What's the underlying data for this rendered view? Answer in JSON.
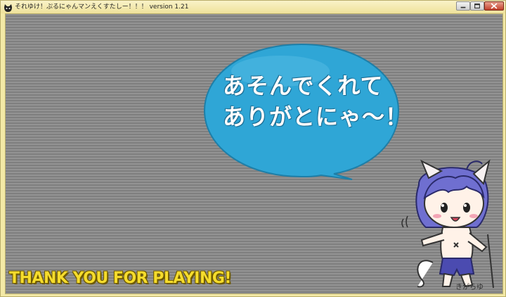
{
  "window": {
    "title": "それゆけ！ぷるにゃんマンえくすたしー！！！ version 1.21"
  },
  "game": {
    "speech_bubble": {
      "line1": "あそんでくれて",
      "line2": "ありがとにゃ～！"
    },
    "banner": "THANK YOU FOR PLAYING!",
    "signature": "きがらゆ"
  },
  "colors": {
    "bubble_fill": "#2fa6d6",
    "banner_text": "#f5dc2c",
    "background_stripe_light": "#939393",
    "background_stripe_dark": "#7f7f7f",
    "window_frame": "#f3e9a6"
  },
  "icons": {
    "app": "cat-face-icon",
    "minimize": "minimize-icon",
    "maximize": "maximize-icon",
    "close": "close-icon"
  }
}
